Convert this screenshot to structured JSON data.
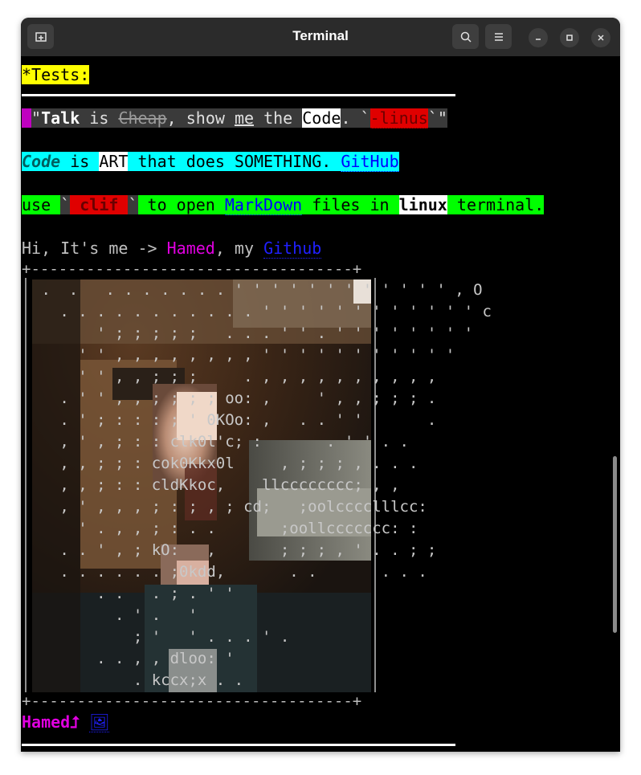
{
  "window": {
    "title": "Terminal"
  },
  "lines": {
    "tests": "*Tests:",
    "quote": {
      "open": "\"",
      "talk": "Talk",
      "is": " is ",
      "cheap": "Cheap",
      "show": ", show ",
      "me": "me",
      "the": " the ",
      "code": "Code",
      "dot": ". `",
      "linus": "-linus",
      "close": "`\""
    },
    "art_line": {
      "code": "Code",
      "is": " is ",
      "art": "ART",
      "rest": " that does SOMETHING. ",
      "github": "GitHub"
    },
    "clif_line": {
      "use": "use ",
      "tick1": "`",
      "clif": " clif ",
      "tick2": "`",
      "to_open": " to open ",
      "markdown": "MarkDown",
      "files_in": " files in ",
      "linux": "linux",
      "terminal": " terminal."
    },
    "hi_line": {
      "hi": "Hi, It's me -> ",
      "hamed": "Hamed",
      "my": ", my ",
      "github": "Github"
    },
    "ascii_top": "+-----------------------------------+",
    "ascii_bottom": "+-----------------------------------+",
    "footer": {
      "name": "Hamed",
      "arrow": "⮥",
      "image_icon": "🖼"
    }
  },
  "ascii_rows": [
    " .  .   . . . . . . . ' ' ' ' ' ' ' ' ' ' ' ' , O",
    "   . . . . . . . . . . . ' ' ' ' ' ' ' ' ' ' ' ' c",
    "       ' ; ; ; ; ;   . . . ' ' . ' ' ' ' ' ' ' '",
    "     ' ' , , , , , , , , ' ' ' ' ' ' ' ' ' ' '",
    "     ' ' , , ; ; ;     . , , , , , , , , , ,",
    "   . ' ' , , ; ; ; ; oo: ,     ' , , ; ; ; .",
    "   . ' ; : : : ; ' 0KOo: ,   . . ' '       .",
    "   , ' , ; : : clk0l'c; :       . ' ' . .",
    "   , , ; ; : cok0Kkx0l     , ; ; ; , . . .",
    "   , , ; : : cldKkoc,    llcccccccc; , ,",
    "   , ' , , , ; : ; , ; cd;   ;oolcccclllcc:",
    "     ' . , , ; : . .       ;oollccccccc: :",
    "   . . ' , ; kO:   ,       ; ; ; , ' . . ; ;",
    "   . . . . . . ;0kdd,       . .       . . .",
    "       . .   . ; . ' '",
    "         . ' .   '",
    "           ; '   ' . . . ' .",
    "       . . , , dloo: '",
    "           . kccx;x . ."
  ]
}
